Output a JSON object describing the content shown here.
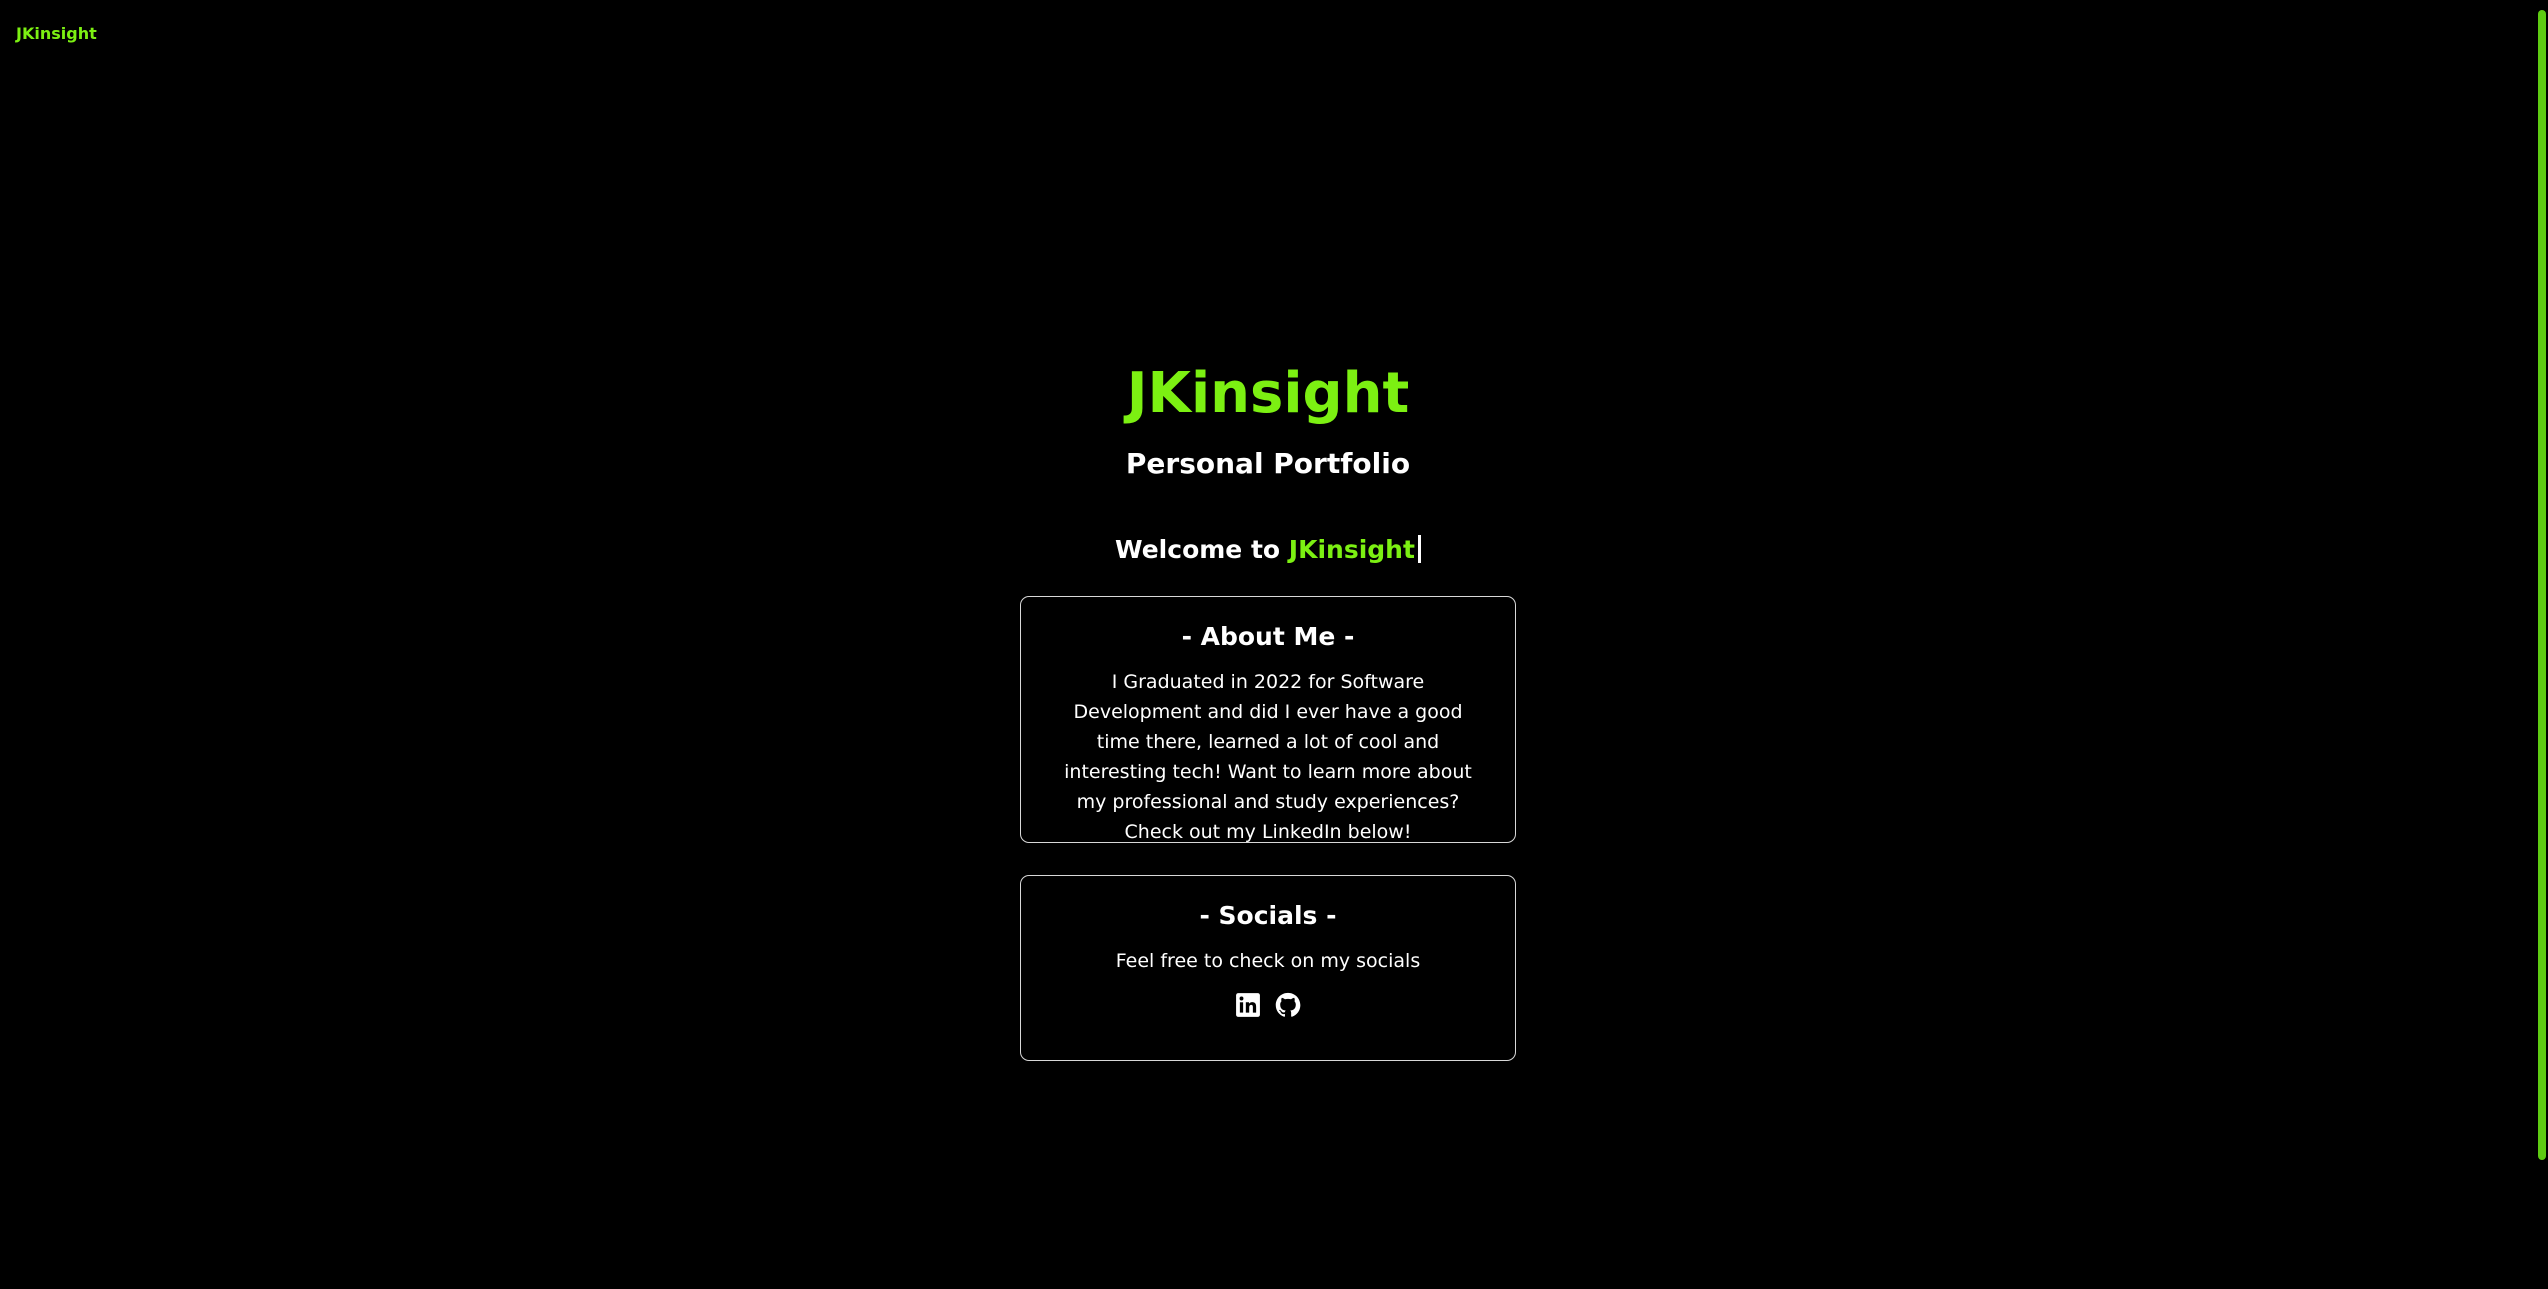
{
  "header": {
    "brand": "JKinsight"
  },
  "hero": {
    "title": "JKinsight",
    "subtitle": "Personal Portfolio",
    "welcome_prefix": "Welcome to ",
    "welcome_accent": "JKinsight"
  },
  "about": {
    "title": "- About Me -",
    "text": "I Graduated in 2022 for Software Development and did I ever have a good time there, learned a lot of cool and interesting tech! Want to learn more about my professional and study experiences? Check out my LinkedIn below!"
  },
  "socials": {
    "title": "- Socials -",
    "text": "Feel free to check on my socials",
    "links": [
      {
        "icon": "linkedin-icon"
      },
      {
        "icon": "github-icon"
      }
    ]
  },
  "colors": {
    "background": "#000000",
    "accent": "#7cf012",
    "text": "#ffffff",
    "card_border": "#d8d8d8",
    "scrollbar": "#5ecb12"
  }
}
